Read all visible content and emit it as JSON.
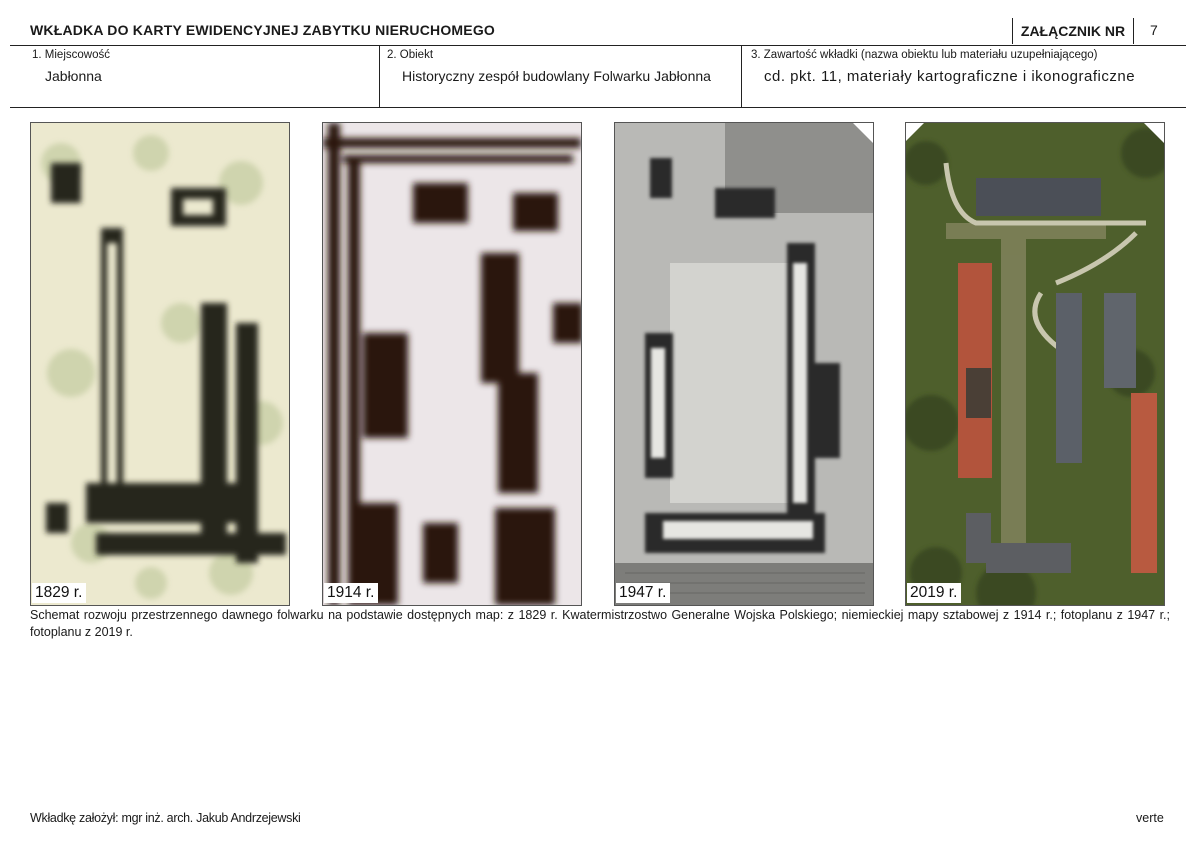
{
  "header": {
    "title": "WKŁADKA DO KARTY EWIDENCYJNEJ ZABYTKU NIERUCHOMEGO",
    "annex_label": "ZAŁĄCZNIK NR",
    "annex_number": "7"
  },
  "fields": [
    {
      "label": "1. Miejscowość",
      "value": "Jabłonna"
    },
    {
      "label": "2. Obiekt",
      "value": "Historyczny zespół budowlany Folwarku Jabłonna"
    },
    {
      "label": "3. Zawartość wkładki (nazwa obiektu lub materiału uzupełniającego)",
      "value": "cd. pkt. 11, materiały kartograficzne i ikonograficzne"
    }
  ],
  "photos": [
    {
      "year": "1829 r.",
      "kind": "historical-map-1829"
    },
    {
      "year": "1914 r.",
      "kind": "staff-map-1914"
    },
    {
      "year": "1947 r.",
      "kind": "aerial-photo-1947"
    },
    {
      "year": "2019 r.",
      "kind": "aerial-photo-2019"
    }
  ],
  "caption": "Schemat rozwoju przestrzennego dawnego folwarku na podstawie dostępnych map: z 1829 r. Kwatermistrzostwo Generalne Wojska Polskiego; niemieckiej mapy sztabowej z 1914 r.; fotoplanu z 1947 r.; fotoplanu z 2019 r.",
  "footer": {
    "author": "Wkładkę założył: mgr inż. arch. Jakub Andrzejewski",
    "verte": "verte"
  }
}
